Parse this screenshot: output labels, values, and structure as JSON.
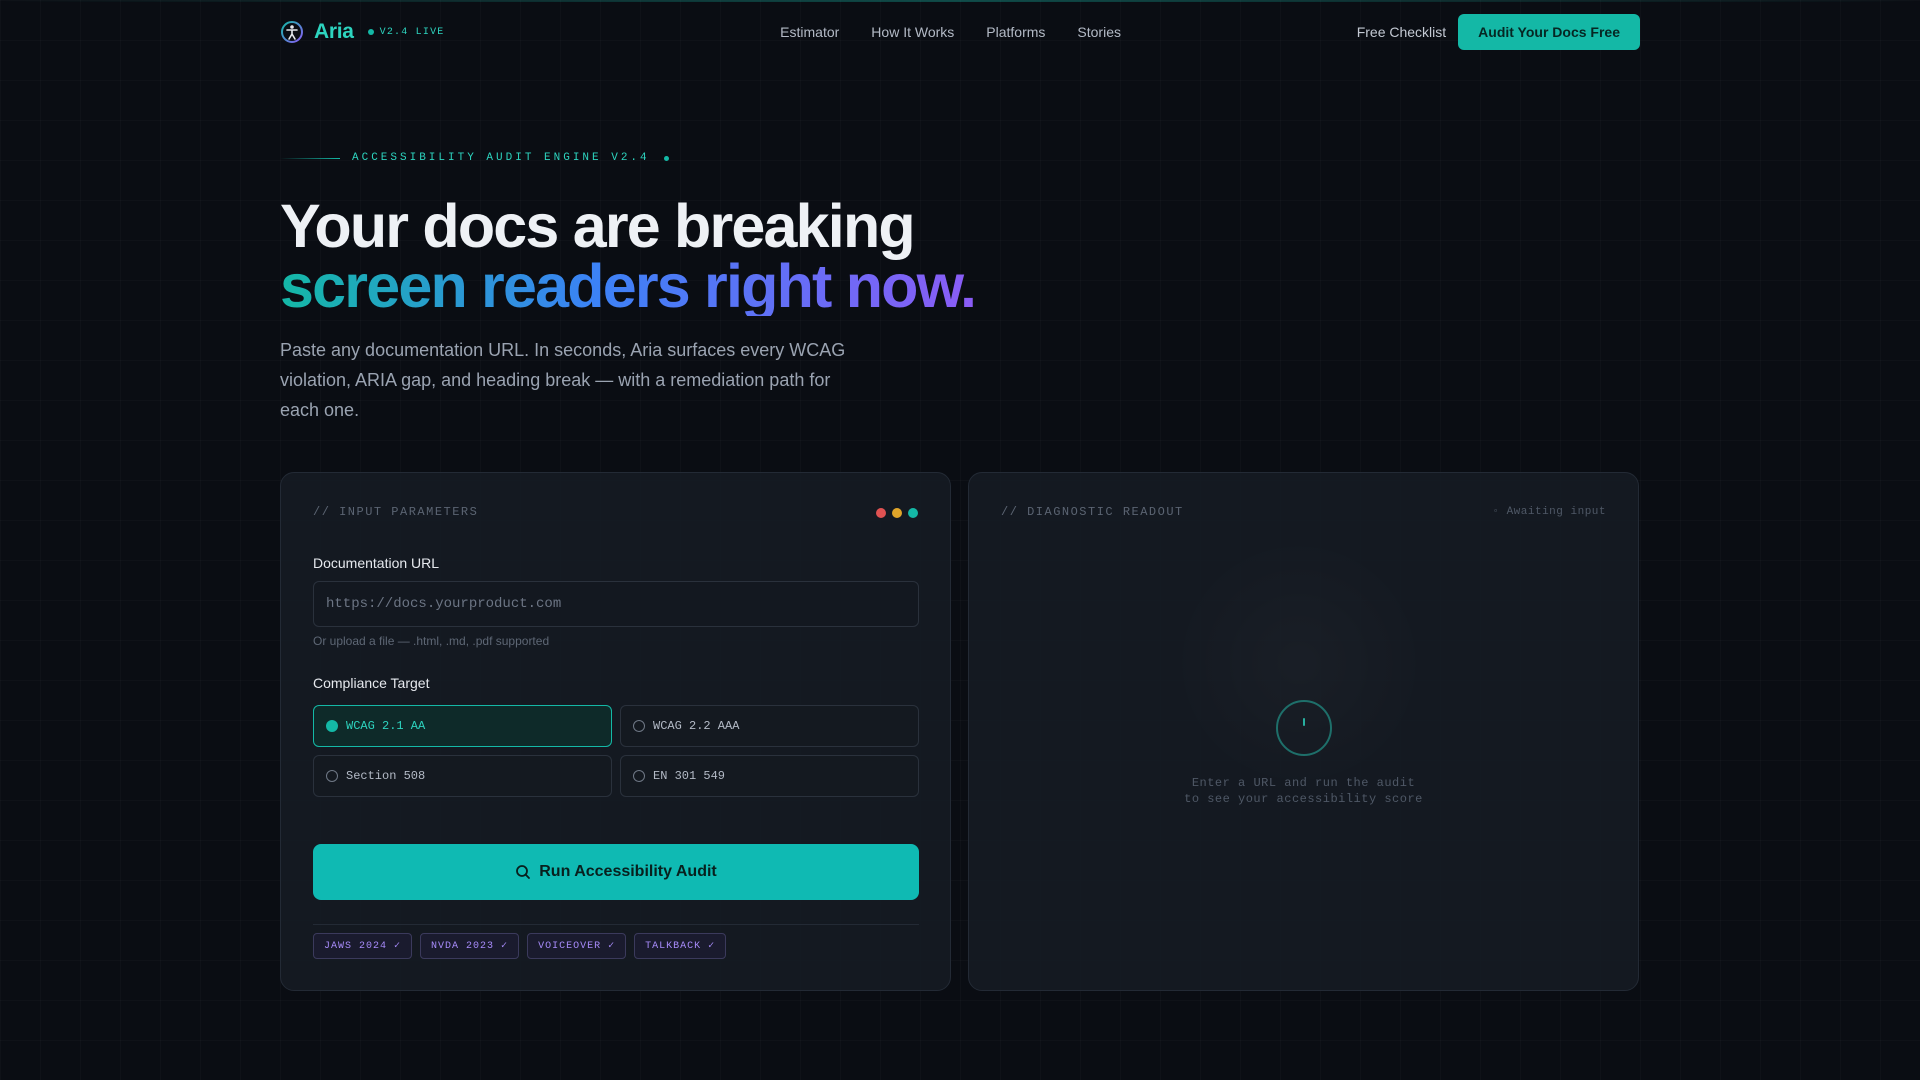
{
  "brand": {
    "name": "Aria",
    "badge": "V2.4 LIVE",
    "logo_icon": "accessibility-icon"
  },
  "nav": {
    "links": [
      "Estimator",
      "How It Works",
      "Platforms",
      "Stories"
    ],
    "checklist": "Free Checklist",
    "cta": "Audit Your Docs Free"
  },
  "hero": {
    "eyebrow": "ACCESSIBILITY AUDIT ENGINE V2.4",
    "title_line1": "Your docs are breaking",
    "title_line2": "screen readers right now.",
    "subtitle": "Paste any documentation URL. In seconds, Aria surfaces every WCAG violation, ARIA gap, and heading break — with a remediation path for each one."
  },
  "input_panel": {
    "label": "// INPUT PARAMETERS",
    "url_label": "Documentation URL",
    "url_placeholder": "https://docs.yourproduct.com",
    "url_value": "",
    "helper": "Or upload a file — .html, .md, .pdf supported",
    "compliance_label": "Compliance Target",
    "options": [
      {
        "label": "WCAG 2.1 AA",
        "selected": true
      },
      {
        "label": "WCAG 2.2 AAA",
        "selected": false
      },
      {
        "label": "Section 508",
        "selected": false
      },
      {
        "label": "EN 301 549",
        "selected": false
      }
    ],
    "run_button": "Run Accessibility Audit",
    "tags": [
      "JAWS 2024 ✓",
      "NVDA 2023 ✓",
      "VOICEOVER ✓",
      "TALKBACK ✓"
    ]
  },
  "output_panel": {
    "label": "// DIAGNOSTIC READOUT",
    "status": "◦ Awaiting input",
    "empty_line1": "Enter a URL and run the audit",
    "empty_line2": "to see your accessibility score"
  },
  "colors": {
    "accent": "#14b8a6",
    "gradient_mid": "#3b82f6",
    "gradient_end": "#8b5cf6",
    "tag_text": "#a78bfa"
  }
}
